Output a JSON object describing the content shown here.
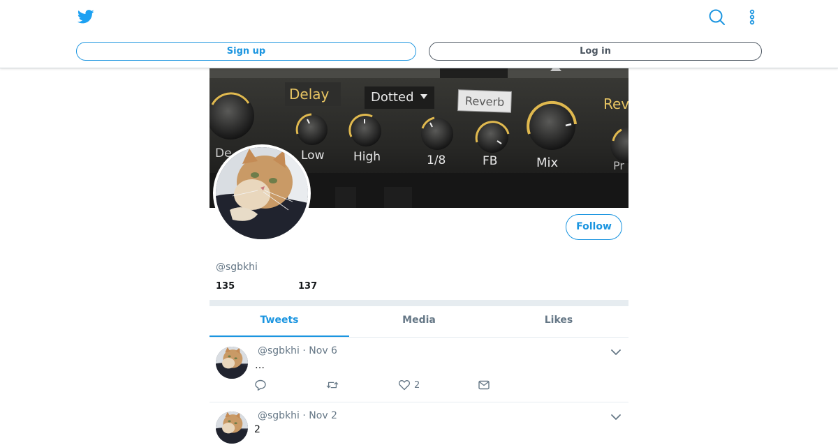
{
  "header": {
    "signup_label": "Sign up",
    "login_label": "Log in"
  },
  "profile": {
    "handle": "@sgbkhi",
    "stats": {
      "first": "135",
      "second": "137"
    },
    "follow_label": "Follow",
    "banner_labels": {
      "delay": "Delay",
      "dotted": "Dotted",
      "reverb": "Reverb",
      "low": "Low",
      "high": "High",
      "eighth": "1/8",
      "fb": "FB",
      "mix": "Mix",
      "rev": "Rev",
      "de": "De",
      "pr": "Pr"
    }
  },
  "tabs": [
    "Tweets",
    "Media",
    "Likes"
  ],
  "tweets": [
    {
      "meta": "@sgbkhi · Nov 6",
      "text": "…",
      "likes": "2"
    },
    {
      "meta": "@sgbkhi · Nov 2",
      "text": "2"
    }
  ],
  "colors": {
    "accent": "#1b95e0",
    "muted": "#657786",
    "band": "#e6ecf0"
  }
}
